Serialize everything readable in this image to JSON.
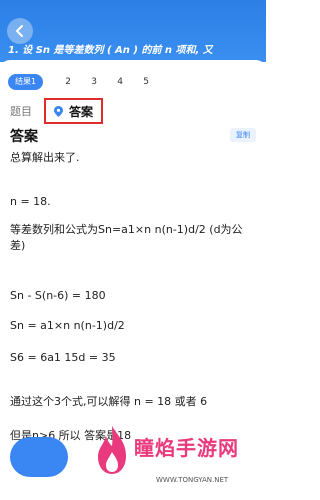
{
  "header": {
    "question_text": "1. 设 Sn 是等差数列 ( An ) 的前 n 项和, 又"
  },
  "tabs": {
    "items": [
      "结果1",
      "2",
      "3",
      "4",
      "5"
    ],
    "active": "结果1"
  },
  "segment": {
    "question_label": "题目",
    "answer_label": "答案"
  },
  "answer": {
    "heading": "答案",
    "copy_label": "复制",
    "lines": [
      "总算解出来了.",
      "n = 18.",
      "等差数列和公式为Sn=a1×n n(n-1)d/2 (d为公差)",
      "Sn - S(n-6) = 180",
      "Sn = a1×n n(n-1)d/2",
      "S6 = 6a1 15d = 35",
      "通过这个3个式,可以解得 n = 18 或者 6",
      "但是n>6 所以 答案是18"
    ]
  },
  "watermark": {
    "title": "瞳焰手游网",
    "url": "WWW.TONGYAN.NET"
  },
  "colors": {
    "brand_blue": "#3a86f2",
    "highlight_red": "#e02c2c",
    "watermark_pink": "#ea3a7e"
  }
}
